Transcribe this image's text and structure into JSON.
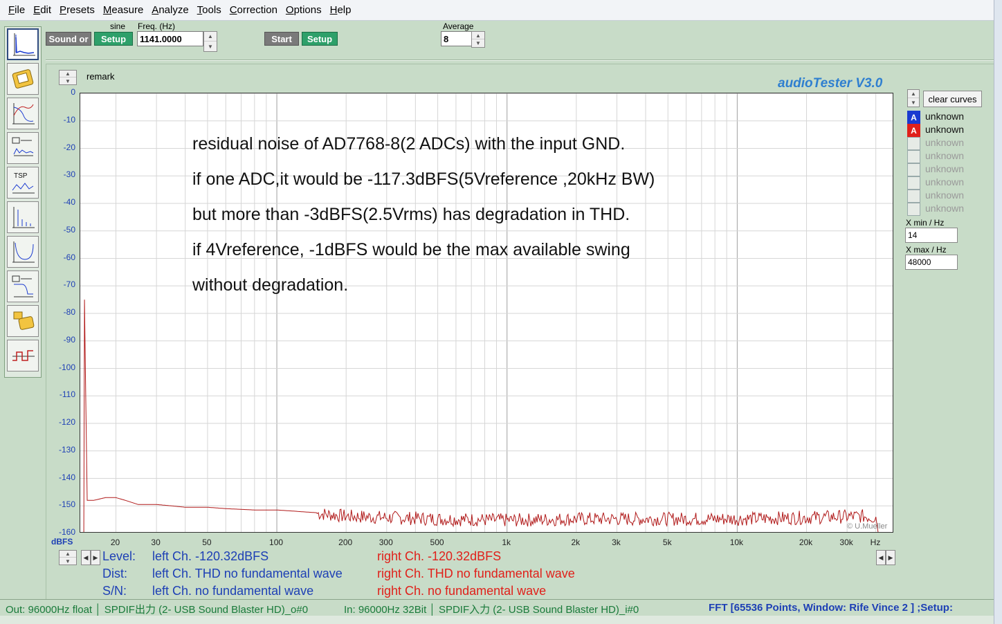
{
  "menu": [
    "File",
    "Edit",
    "Presets",
    "Measure",
    "Analyze",
    "Tools",
    "Correction",
    "Options",
    "Help"
  ],
  "menu_underline": [
    "F",
    "E",
    "P",
    "M",
    "A",
    "T",
    "C",
    "O",
    "H"
  ],
  "menu_rest": [
    "ile",
    "dit",
    "resets",
    "easure",
    "nalyze",
    "ools",
    "orrection",
    "ptions",
    "elp"
  ],
  "toolbar_top": {
    "sound_button": "Sound or",
    "signal_type": "sine",
    "setup1": "Setup",
    "freq_label": "Freq. (Hz)",
    "freq_value": "1141.0000",
    "start": "Start",
    "setup2": "Setup",
    "average_label": "Average",
    "average_value": "8"
  },
  "graph": {
    "remark": "remark",
    "app_title": "audioTester  V3.0",
    "y_unit": "dBFS",
    "x_unit": "Hz",
    "copyright": "© U.Mueller",
    "annotation": [
      "residual noise of AD7768-8(2 ADCs) with the input GND.",
      "if one ADC,it would be -117.3dBFS(5Vreference ,20kHz BW)",
      "but more than -3dBFS(2.5Vrms) has degradation in THD.",
      "if 4Vreference, -1dBFS would be the max available swing",
      "without degradation."
    ]
  },
  "chart_data": {
    "type": "line",
    "x_scale": "log",
    "xlim": [
      14,
      48000
    ],
    "ylim": [
      -160,
      0
    ],
    "y_ticks": [
      "0",
      "-10",
      "-20",
      "-30",
      "-40",
      "-50",
      "-60",
      "-70",
      "-80",
      "-90",
      "-100",
      "-110",
      "-120",
      "-130",
      "-140",
      "-150",
      "-160"
    ],
    "x_ticks": [
      {
        "v": 20,
        "label": "20"
      },
      {
        "v": 30,
        "label": "30"
      },
      {
        "v": 50,
        "label": "50"
      },
      {
        "v": 100,
        "label": "100"
      },
      {
        "v": 200,
        "label": "200"
      },
      {
        "v": 300,
        "label": "300"
      },
      {
        "v": 500,
        "label": "500"
      },
      {
        "v": 1000,
        "label": "1k"
      },
      {
        "v": 2000,
        "label": "2k"
      },
      {
        "v": 3000,
        "label": "3k"
      },
      {
        "v": 5000,
        "label": "5k"
      },
      {
        "v": 10000,
        "label": "10k"
      },
      {
        "v": 20000,
        "label": "20k"
      },
      {
        "v": 30000,
        "label": "30k"
      }
    ],
    "grid": true,
    "series": [
      {
        "color": "#b01818",
        "points": [
          [
            14.5,
            -160
          ],
          [
            14.6,
            -75
          ],
          [
            14.8,
            -112
          ],
          [
            15,
            -148
          ],
          [
            16,
            -148
          ],
          [
            18,
            -147
          ],
          [
            20,
            -147
          ],
          [
            22,
            -148
          ],
          [
            25,
            -149.5
          ],
          [
            30,
            -149.5
          ],
          [
            35,
            -150
          ],
          [
            40,
            -150.5
          ],
          [
            50,
            -150.5
          ],
          [
            60,
            -151
          ],
          [
            80,
            -151.5
          ],
          [
            100,
            -151.5
          ],
          [
            150,
            -152.5
          ],
          [
            200,
            -153.5
          ],
          [
            300,
            -154
          ],
          [
            500,
            -154.5
          ],
          [
            1000,
            -155
          ],
          [
            2000,
            -154.5
          ],
          [
            5000,
            -154.5
          ],
          [
            10000,
            -154.5
          ],
          [
            20000,
            -154
          ],
          [
            35000,
            -153.5
          ],
          [
            40000,
            -154
          ],
          [
            41000,
            -160
          ],
          [
            48000,
            -160
          ]
        ]
      }
    ]
  },
  "right_panel": {
    "clear_curves": "clear curves",
    "curves": [
      {
        "box": "A",
        "color": "#1a3ad0",
        "label": "unknown",
        "active": true
      },
      {
        "box": "A",
        "color": "#e0201a",
        "label": "unknown",
        "active": true
      },
      {
        "box": "",
        "color": "",
        "label": "unknown",
        "active": false
      },
      {
        "box": "",
        "color": "",
        "label": "unknown",
        "active": false
      },
      {
        "box": "",
        "color": "",
        "label": "unknown",
        "active": false
      },
      {
        "box": "",
        "color": "",
        "label": "unknown",
        "active": false
      },
      {
        "box": "",
        "color": "",
        "label": "unknown",
        "active": false
      },
      {
        "box": "",
        "color": "",
        "label": "unknown",
        "active": false
      }
    ],
    "xmin_label": "X min  /  Hz",
    "xmin_value": "14",
    "xmax_label": "X max  /  Hz",
    "xmax_value": "48000"
  },
  "results": {
    "level_label": "Level:",
    "level_left": "left Ch. -120.32dBFS",
    "level_right": "right Ch. -120.32dBFS",
    "dist_label": "Dist:",
    "dist_left": "left Ch. THD no fundamental wave",
    "dist_right": "right Ch. THD no fundamental wave",
    "sn_label": "S/N:",
    "sn_left": "left Ch.  no fundamental wave",
    "sn_right": "right Ch.  no fundamental wave"
  },
  "status": {
    "out": "Out: 96000Hz float  │ SPDIF出力 (2- USB Sound Blaster HD)_o#0",
    "in": "In: 96000Hz 32Bit  │ SPDIF入力 (2- USB Sound Blaster HD)_i#0",
    "fft": "FFT [65536 Points, Window: Rife Vince 2 ]  ;Setup: "
  }
}
